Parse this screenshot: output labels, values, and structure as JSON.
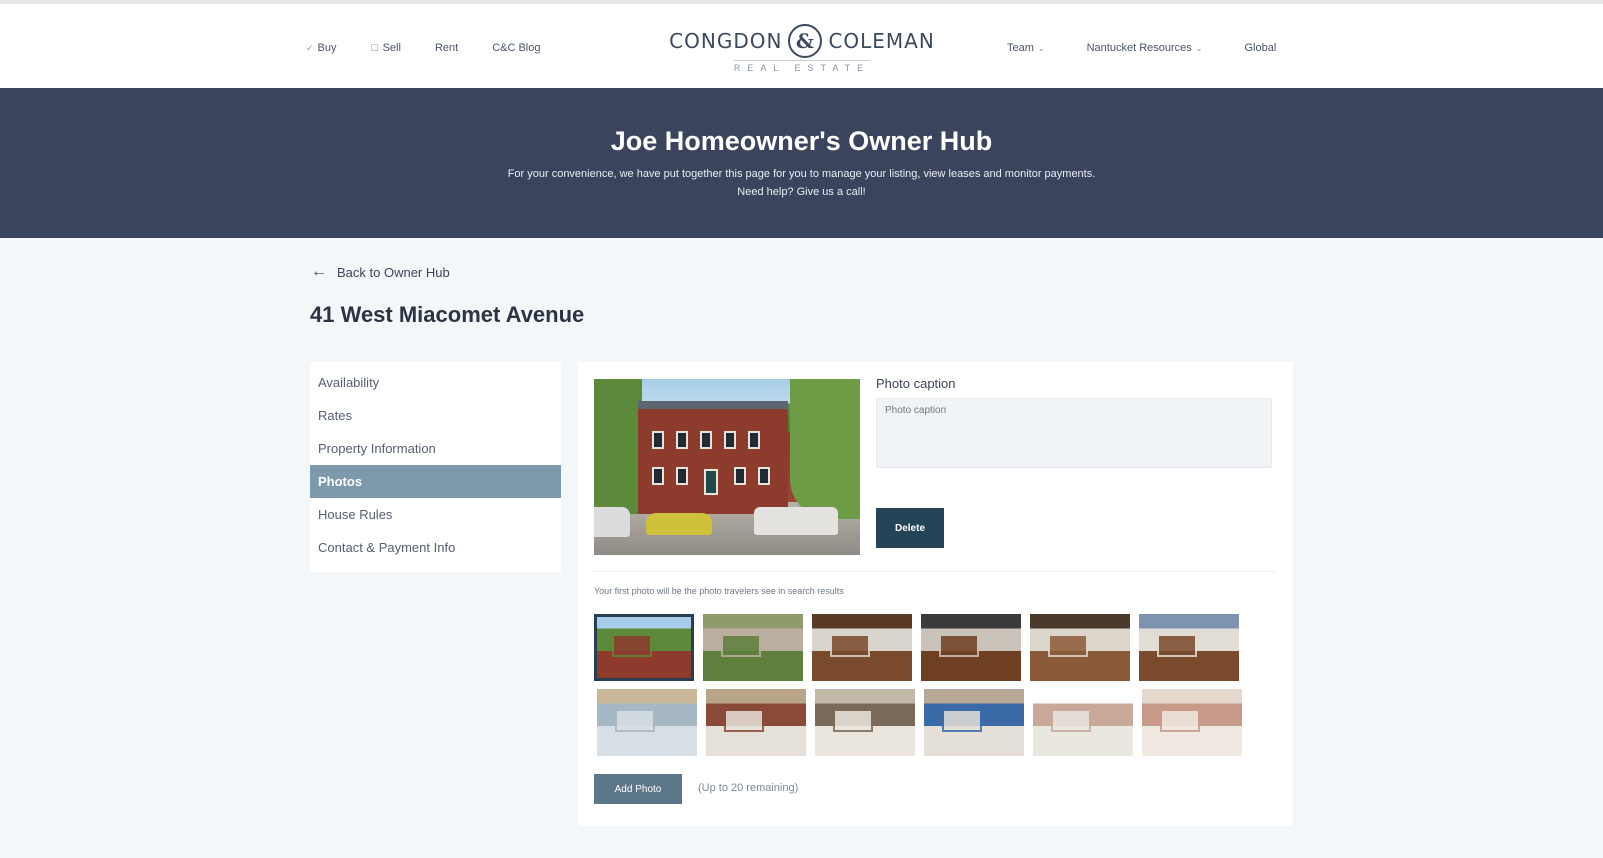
{
  "nav": {
    "left": [
      {
        "label": "Buy",
        "icon": "check-icon"
      },
      {
        "label": "Sell",
        "icon": "checkbox-icon"
      },
      {
        "label": "Rent"
      },
      {
        "label": "C&C Blog"
      }
    ],
    "right": [
      {
        "label": "Team",
        "has_dropdown": true
      },
      {
        "label": "Nantucket Resources",
        "has_dropdown": true
      },
      {
        "label": "Global"
      }
    ],
    "logo": {
      "left_word": "CONGDON",
      "ampersand": "&",
      "right_word": "COLEMAN",
      "tagline": "REAL ESTATE"
    }
  },
  "hero": {
    "title": "Joe Homeowner's Owner Hub",
    "subtitle_line1": "For your convenience, we have put together this page for you to manage your listing, view leases and monitor payments.",
    "subtitle_line2": "Need help? Give us a call!"
  },
  "back_link": {
    "label": "Back to Owner Hub",
    "icon": "arrow-left-icon"
  },
  "page_title": "41 West Miacomet Avenue",
  "side_menu": {
    "items": [
      {
        "label": "Availability",
        "active": false
      },
      {
        "label": "Rates",
        "active": false
      },
      {
        "label": "Property Information",
        "active": false
      },
      {
        "label": "Photos",
        "active": true
      },
      {
        "label": "House Rules",
        "active": false
      },
      {
        "label": "Contact & Payment Info",
        "active": false
      }
    ]
  },
  "photo_editor": {
    "caption_label": "Photo caption",
    "caption_placeholder": "Photo caption",
    "caption_value": "",
    "delete_label": "Delete",
    "hint": "Your first photo will be the photo travelers see in search results",
    "add_photo_label": "Add Photo",
    "remaining_text": "(Up to 20 remaining)",
    "thumbnails": [
      {
        "alt": "exterior",
        "selected": true,
        "colors": [
          "#8d3b2d",
          "#5d8a3a",
          "#a8cde8"
        ]
      },
      {
        "alt": "garden",
        "selected": false,
        "colors": [
          "#5f7f3c",
          "#b9aea0",
          "#8e9b6a"
        ]
      },
      {
        "alt": "kitchen",
        "selected": false,
        "colors": [
          "#7a4a2c",
          "#d9d4cc",
          "#5a3a24"
        ]
      },
      {
        "alt": "kitchen-2",
        "selected": false,
        "colors": [
          "#6e3f22",
          "#c9c3ba",
          "#3a3a3a"
        ]
      },
      {
        "alt": "dining",
        "selected": false,
        "colors": [
          "#8a5a38",
          "#dcd6cc",
          "#4a3a2c"
        ]
      },
      {
        "alt": "bedroom",
        "selected": false,
        "colors": [
          "#7a4a2c",
          "#e2ddd4",
          "#7e93b0"
        ]
      },
      {
        "alt": "living-room",
        "selected": false,
        "colors": [
          "#d8dfe4",
          "#a5b8c4",
          "#c9b79a"
        ]
      },
      {
        "alt": "living-room-2",
        "selected": false,
        "colors": [
          "#e6e1d8",
          "#8a4a38",
          "#b8a488"
        ]
      },
      {
        "alt": "sitting-room",
        "selected": false,
        "colors": [
          "#eae6de",
          "#7a6a5a",
          "#c2b8a8"
        ]
      },
      {
        "alt": "family-room",
        "selected": false,
        "colors": [
          "#e4e0d8",
          "#3a6aa8",
          "#b8a898"
        ]
      },
      {
        "alt": "bedroom-2",
        "selected": false,
        "colors": [
          "#eae6e0",
          "#c9a89a",
          "#ffffff"
        ]
      },
      {
        "alt": "bedroom-3",
        "selected": false,
        "colors": [
          "#efe9e2",
          "#c89a8a",
          "#e4d8cc"
        ]
      }
    ]
  },
  "colors": {
    "hero_bg": "#3a455d",
    "active_menu": "#7c9aab",
    "delete_button": "#234457",
    "add_photo_button": "#5c7789"
  }
}
